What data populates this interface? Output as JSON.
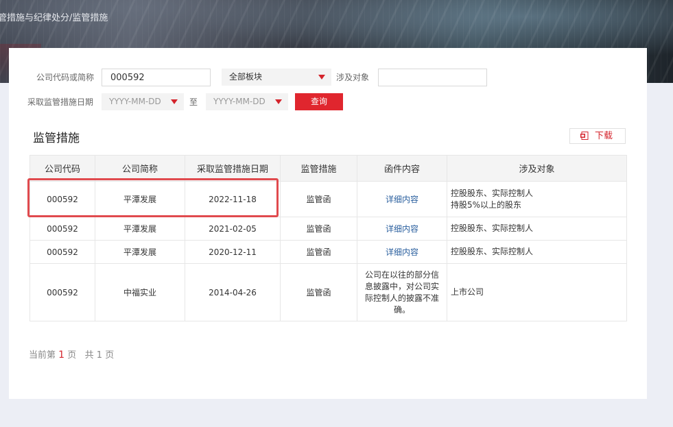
{
  "breadcrumb": "管措施与纪律处分/监管措施",
  "filters": {
    "company_label": "公司代码或简称",
    "company_value": "000592",
    "board_select": "全部板块",
    "target_label": "涉及对象",
    "target_value": "",
    "date_label": "采取监管措施日期",
    "date_from_placeholder": "YYYY-MM-DD",
    "date_to_label": "至",
    "date_to_placeholder": "YYYY-MM-DD",
    "query_button": "查询"
  },
  "section_title": "监管措施",
  "download_button": "下载",
  "table": {
    "headers": [
      "公司代码",
      "公司简称",
      "采取监管措施日期",
      "监管措施",
      "函件内容",
      "涉及对象"
    ],
    "rows": [
      {
        "code": "000592",
        "name": "平潭发展",
        "date": "2022-11-18",
        "measure": "监管函",
        "content": "详细内容",
        "target_line1": "控股股东、实际控制人",
        "target_line2": "持股5%以上的股东"
      },
      {
        "code": "000592",
        "name": "平潭发展",
        "date": "2021-02-05",
        "measure": "监管函",
        "content": "详细内容",
        "target_line1": "控股股东、实际控制人",
        "target_line2": ""
      },
      {
        "code": "000592",
        "name": "平潭发展",
        "date": "2020-12-11",
        "measure": "监管函",
        "content": "详细内容",
        "target_line1": "控股股东、实际控制人",
        "target_line2": ""
      },
      {
        "code": "000592",
        "name": "中福实业",
        "date": "2014-04-26",
        "measure": "监管函",
        "content": "公司在以往的部分信息披露中，对公司实际控制人的披露不准确。",
        "target_line1": "上市公司",
        "target_line2": ""
      }
    ]
  },
  "pager": {
    "prefix": "当前第",
    "current_page": "1",
    "page_unit": "页",
    "total_prefix": "共",
    "total_pages": "1",
    "total_unit": "页"
  },
  "colors": {
    "accent": "#e0262e",
    "link": "#2a5f9e",
    "highlight_box": "#e04a4e"
  }
}
